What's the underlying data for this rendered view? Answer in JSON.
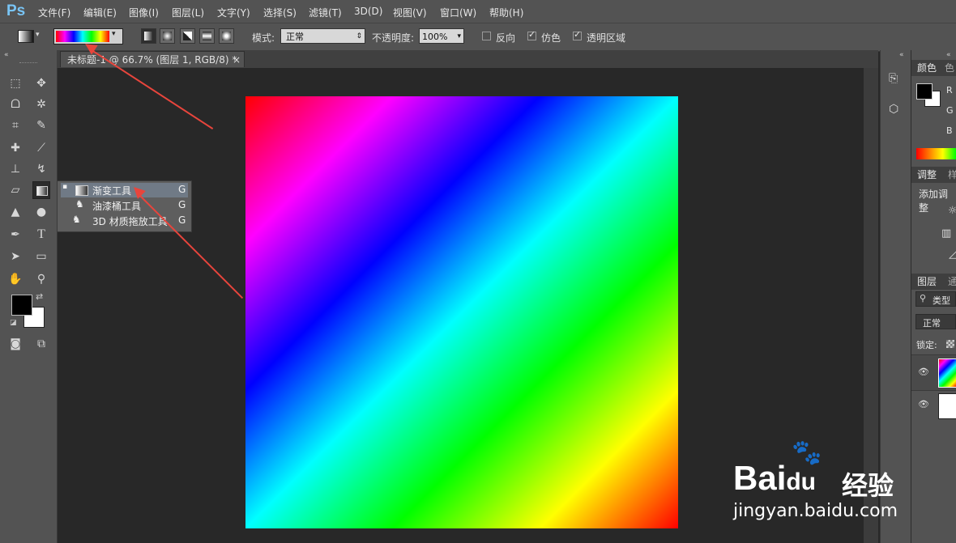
{
  "app": {
    "logo": "Ps"
  },
  "menu": [
    "文件(F)",
    "编辑(E)",
    "图像(I)",
    "图层(L)",
    "文字(Y)",
    "选择(S)",
    "滤镜(T)",
    "3D(D)",
    "视图(V)",
    "窗口(W)",
    "帮助(H)"
  ],
  "options": {
    "mode_label": "模式:",
    "mode_value": "正常",
    "opacity_label": "不透明度:",
    "opacity_value": "100%",
    "reverse_label": "反向",
    "reverse_checked": false,
    "dither_label": "仿色",
    "dither_checked": true,
    "transparency_label": "透明区域",
    "transparency_checked": true
  },
  "document": {
    "tab_title": "未标题-1 @ 66.7% (图层 1, RGB/8) *",
    "close": "×"
  },
  "flyout": {
    "items": [
      {
        "label": "渐变工具",
        "shortcut": "G",
        "selected": true
      },
      {
        "label": "油漆桶工具",
        "shortcut": "G",
        "selected": false
      },
      {
        "label": "3D 材质拖放工具",
        "shortcut": "G",
        "selected": false
      }
    ]
  },
  "panels": {
    "color_tab": "颜色",
    "color_tab2": "色",
    "channels": [
      "R",
      "G",
      "B"
    ],
    "adjust_tab": "调整",
    "adjust_tab2": "样",
    "adjust_add": "添加调整",
    "layers_tab": "图层",
    "layers_tab2": "通",
    "layers_filter": "类型",
    "layers_mode": "正常",
    "layers_lock": "锁定:"
  },
  "watermark": {
    "brand": "Bai",
    "brand2": "du",
    "cn": "经验",
    "url": "jingyan.baidu.com"
  },
  "colors": {
    "accent_arrow": "#e8453c",
    "ui_bg": "#535353",
    "workspace": "#282828"
  }
}
